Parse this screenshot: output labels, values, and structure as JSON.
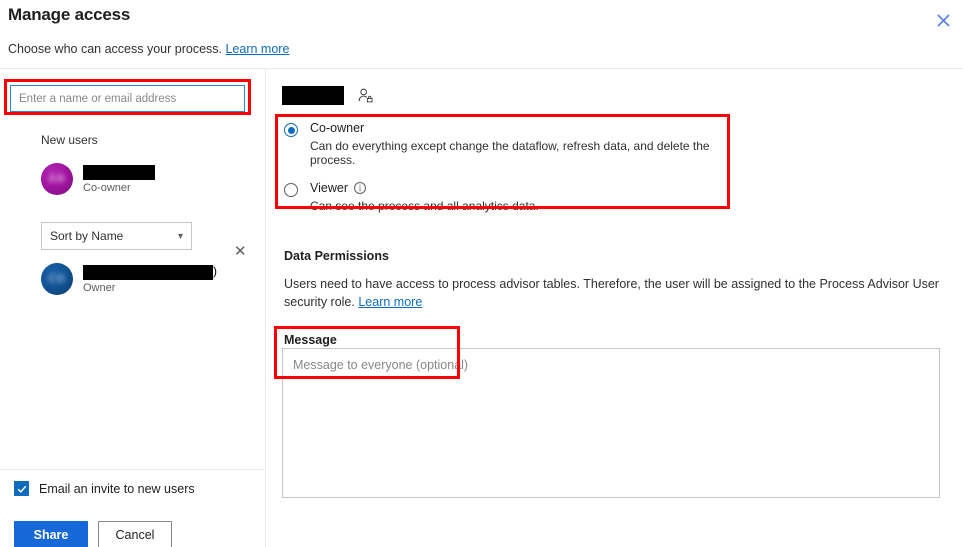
{
  "header": {
    "title": "Manage access",
    "subtitle_text": "Choose who can access your process.",
    "learn_more": "Learn more",
    "close_icon": "close-icon",
    "accent_color": "#0f6cbd",
    "annotation_color": "#fb0007"
  },
  "left": {
    "search": {
      "placeholder": "Enter a name or email address",
      "value": ""
    },
    "new_users_label": "New users",
    "new_users": [
      {
        "name": "",
        "role": "Co-owner",
        "avatar_color": "#a114a1",
        "remove_icon": "close-icon"
      }
    ],
    "sort": {
      "selected": "Sort by Name",
      "chevron_icon": "chevron-down-icon"
    },
    "existing_users": [
      {
        "name": "",
        "name_tail": ")",
        "role": "Owner",
        "avatar_color": "#125495"
      }
    ],
    "email_invite": {
      "label": "Email an invite to new users",
      "checked": true
    },
    "buttons": {
      "share": "Share",
      "cancel": "Cancel"
    }
  },
  "right": {
    "selected_user_name": "",
    "person_icon": "person-add-icon",
    "roles": [
      {
        "title": "Co-owner",
        "description": "Can do everything except change the dataflow, refresh data, and delete the process.",
        "selected": true,
        "has_info": false
      },
      {
        "title": "Viewer",
        "description": "Can see the process and all analytics data.",
        "selected": false,
        "has_info": true,
        "info_icon": "info-icon"
      }
    ],
    "data_permissions": {
      "title": "Data Permissions",
      "body": "Users need to have access to process advisor tables. Therefore, the user will be assigned to the Process Advisor User security role.",
      "learn_more": "Learn more"
    },
    "message": {
      "label": "Message",
      "placeholder": "Message to everyone (optional)",
      "value": ""
    }
  }
}
